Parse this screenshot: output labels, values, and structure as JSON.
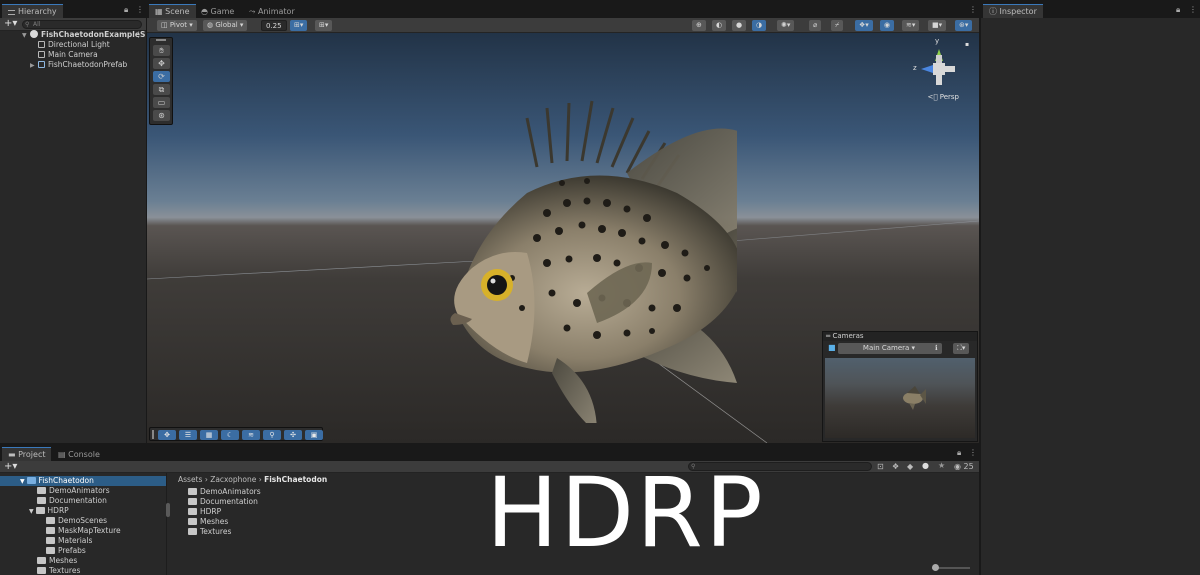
{
  "hierarchy": {
    "tab_label": "Hierarchy",
    "search_placeholder": "All",
    "items": [
      {
        "label": "FishChaetodonExampleS",
        "level": 0,
        "kind": "scene"
      },
      {
        "label": "Directional Light",
        "level": 1,
        "kind": "object"
      },
      {
        "label": "Main Camera",
        "level": 1,
        "kind": "object"
      },
      {
        "label": "FishChaetodonPrefab",
        "level": 1,
        "kind": "prefab"
      }
    ]
  },
  "scene_tabs": [
    "Scene",
    "Game",
    "Animator"
  ],
  "scene_toolbar": {
    "pivot": "Pivot",
    "global": "Global",
    "snap_value": "0.25"
  },
  "viewport": {
    "persp_label": "Persp",
    "gizmo_y": "y",
    "gizmo_z": "z"
  },
  "cameras": {
    "title": "Cameras",
    "selected": "Main Camera"
  },
  "inspector": {
    "tab_label": "Inspector"
  },
  "project": {
    "tabs": [
      "Project",
      "Console"
    ],
    "tree": [
      {
        "label": "FishChaetodon",
        "level": 0,
        "selected": true
      },
      {
        "label": "DemoAnimators",
        "level": 1
      },
      {
        "label": "Documentation",
        "level": 1
      },
      {
        "label": "HDRP",
        "level": 1
      },
      {
        "label": "DemoScenes",
        "level": 2
      },
      {
        "label": "MaskMapTexture",
        "level": 2
      },
      {
        "label": "Materials",
        "level": 2
      },
      {
        "label": "Prefabs",
        "level": 2
      },
      {
        "label": "Meshes",
        "level": 1
      },
      {
        "label": "Textures",
        "level": 1
      }
    ],
    "breadcrumb": [
      "Assets",
      "Zacxophone",
      "FishChaetodon"
    ],
    "contents": [
      "DemoAnimators",
      "Documentation",
      "HDRP",
      "Meshes",
      "Textures"
    ],
    "visible_count": "25"
  },
  "watermark": "HDRP",
  "colors": {
    "accent": "#3b6da3",
    "selection": "#2c5d87",
    "folder": "#c6c6c6"
  }
}
